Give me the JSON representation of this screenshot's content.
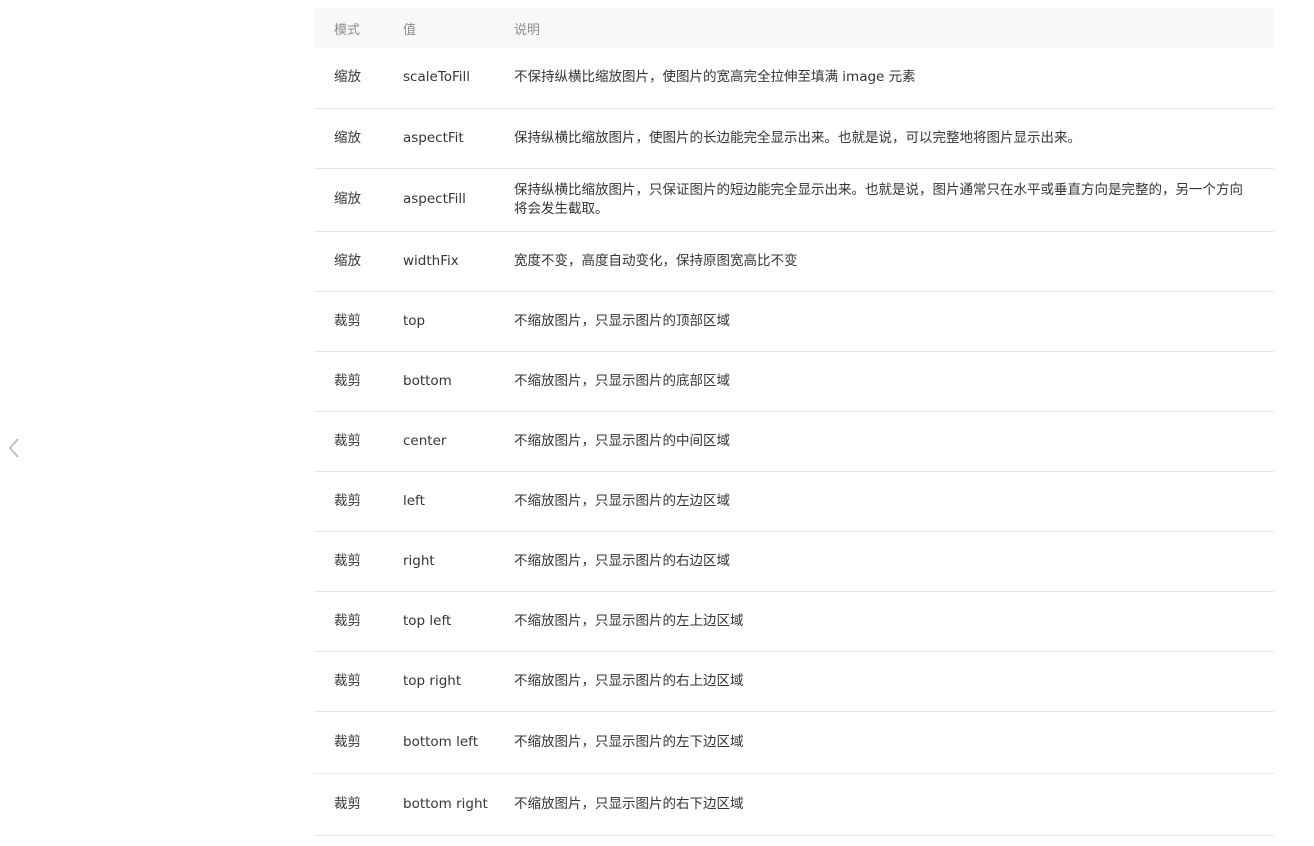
{
  "table": {
    "headers": [
      "模式",
      "值",
      "说明"
    ],
    "rows": [
      {
        "mode": "缩放",
        "value": "scaleToFill",
        "desc": "不保持纵横比缩放图片，使图片的宽高完全拉伸至填满 image 元素"
      },
      {
        "mode": "缩放",
        "value": "aspectFit",
        "desc": "保持纵横比缩放图片，使图片的长边能完全显示出来。也就是说，可以完整地将图片显示出来。"
      },
      {
        "mode": "缩放",
        "value": "aspectFill",
        "desc": "保持纵横比缩放图片，只保证图片的短边能完全显示出来。也就是说，图片通常只在水平或垂直方向是完整的，另一个方向将会发生截取。"
      },
      {
        "mode": "缩放",
        "value": "widthFix",
        "desc": "宽度不变，高度自动变化，保持原图宽高比不变"
      },
      {
        "mode": "裁剪",
        "value": "top",
        "desc": "不缩放图片，只显示图片的顶部区域"
      },
      {
        "mode": "裁剪",
        "value": "bottom",
        "desc": "不缩放图片，只显示图片的底部区域"
      },
      {
        "mode": "裁剪",
        "value": "center",
        "desc": "不缩放图片，只显示图片的中间区域"
      },
      {
        "mode": "裁剪",
        "value": "left",
        "desc": "不缩放图片，只显示图片的左边区域"
      },
      {
        "mode": "裁剪",
        "value": "right",
        "desc": "不缩放图片，只显示图片的右边区域"
      },
      {
        "mode": "裁剪",
        "value": "top left",
        "desc": "不缩放图片，只显示图片的左上边区域"
      },
      {
        "mode": "裁剪",
        "value": "top right",
        "desc": "不缩放图片，只显示图片的右上边区域"
      },
      {
        "mode": "裁剪",
        "value": "bottom left",
        "desc": "不缩放图片，只显示图片的左下边区域"
      },
      {
        "mode": "裁剪",
        "value": "bottom right",
        "desc": "不缩放图片，只显示图片的右下边区域"
      }
    ]
  },
  "nav": {
    "prev_icon": "chevron-left-icon"
  }
}
